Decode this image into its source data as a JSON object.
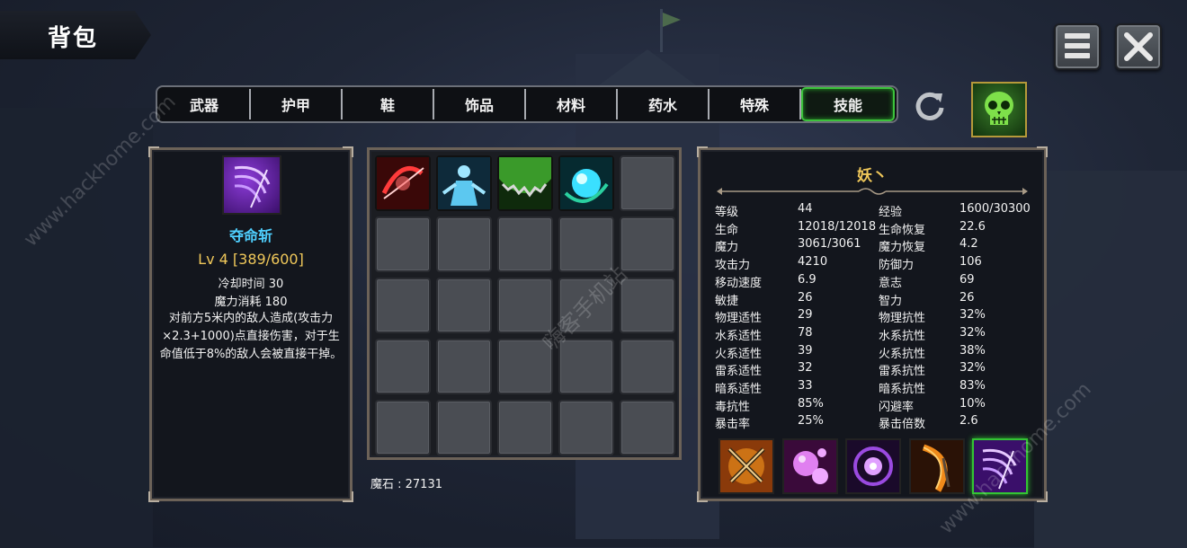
{
  "header": {
    "title": "背包"
  },
  "tabs": [
    {
      "label": "武器",
      "active": false
    },
    {
      "label": "护甲",
      "active": false
    },
    {
      "label": "鞋",
      "active": false
    },
    {
      "label": "饰品",
      "active": false
    },
    {
      "label": "材料",
      "active": false
    },
    {
      "label": "药水",
      "active": false
    },
    {
      "label": "特殊",
      "active": false
    },
    {
      "label": "技能",
      "active": true
    }
  ],
  "skill_detail": {
    "name": "夺命斩",
    "level": "Lv 4 [389/600]",
    "cooldown": "冷却时间 30",
    "mana_cost": "魔力消耗 180",
    "description": "对前方5米内的敌人造成(攻击力×2.3+1000)点直接伤害，对于生命值低于8%的敌人会被直接干掉。"
  },
  "inventory": {
    "slots": [
      "red-slash-skill",
      "ice-figure-skill",
      "green-saw-skill",
      "cyan-orb-skill",
      "",
      "",
      "",
      "",
      "",
      "",
      "",
      "",
      "",
      "",
      "",
      "",
      "",
      "",
      "",
      "",
      "",
      "",
      "",
      "",
      ""
    ]
  },
  "currency": {
    "text": "魔石 : 27131"
  },
  "character": {
    "name": "妖丶",
    "stats": [
      {
        "label": "等级",
        "value": "44"
      },
      {
        "label": "经验",
        "value": "1600/30300"
      },
      {
        "label": "生命",
        "value": "12018/12018"
      },
      {
        "label": "生命恢复",
        "value": "22.6"
      },
      {
        "label": "魔力",
        "value": "3061/3061"
      },
      {
        "label": "魔力恢复",
        "value": "4.2"
      },
      {
        "label": "攻击力",
        "value": "4210"
      },
      {
        "label": "防御力",
        "value": "106"
      },
      {
        "label": "移动速度",
        "value": "6.9"
      },
      {
        "label": "意志",
        "value": "69"
      },
      {
        "label": "敏捷",
        "value": "26"
      },
      {
        "label": "智力",
        "value": "26"
      },
      {
        "label": "物理适性",
        "value": "29"
      },
      {
        "label": "物理抗性",
        "value": "32%"
      },
      {
        "label": "水系适性",
        "value": "78"
      },
      {
        "label": "水系抗性",
        "value": "32%"
      },
      {
        "label": "火系适性",
        "value": "39"
      },
      {
        "label": "火系抗性",
        "value": "38%"
      },
      {
        "label": "雷系适性",
        "value": "32"
      },
      {
        "label": "雷系抗性",
        "value": "32%"
      },
      {
        "label": "暗系适性",
        "value": "33"
      },
      {
        "label": "暗系抗性",
        "value": "83%"
      },
      {
        "label": "毒抗性",
        "value": "85%"
      },
      {
        "label": "闪避率",
        "value": "10%"
      },
      {
        "label": "暴击率",
        "value": "25%"
      },
      {
        "label": "暴击倍数",
        "value": "2.6"
      }
    ],
    "equipped_skills": [
      "crossed-swords-skill",
      "pink-bubbles-skill",
      "purple-vortex-skill",
      "fire-blade-skill",
      "purple-scythe-skill"
    ]
  },
  "watermarks": [
    "www.hackhome.com",
    "嗨客手机站",
    "www.hackhome.com"
  ],
  "colors": {
    "active_tab": "#3cc23c",
    "skill_name": "#4fd0ff",
    "level": "#f0c85a",
    "char_name": "#f0c85a"
  }
}
